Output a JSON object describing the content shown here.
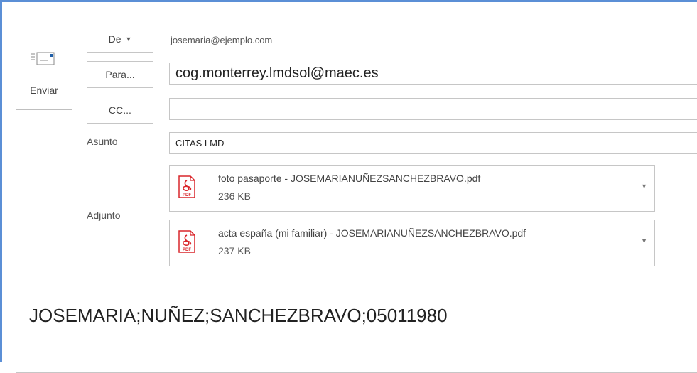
{
  "send": {
    "label": "Enviar",
    "icon": "send-mail-icon"
  },
  "from": {
    "button_label": "De",
    "value": "josemaria@ejemplo.com"
  },
  "to": {
    "button_label": "Para...",
    "value": "cog.monterrey.lmdsol@maec.es"
  },
  "cc": {
    "button_label": "CC...",
    "value": ""
  },
  "subject": {
    "label": "Asunto",
    "value": "CITAS LMD"
  },
  "attachments": {
    "label": "Adjunto",
    "items": [
      {
        "name": "foto pasaporte - JOSEMARIANUÑEZSANCHEZBRAVO.pdf",
        "size": "236 KB",
        "icon": "pdf-icon",
        "icon_text": "PDF"
      },
      {
        "name": "acta españa (mi familiar) - JOSEMARIANUÑEZSANCHEZBRAVO.pdf",
        "size": "237 KB",
        "icon": "pdf-icon",
        "icon_text": "PDF"
      }
    ]
  },
  "message": {
    "body": "JOSEMARIA;NUÑEZ;SANCHEZBRAVO;05011980"
  },
  "colors": {
    "accent_border": "#5b8fd6",
    "pdf_red": "#d9262b"
  }
}
